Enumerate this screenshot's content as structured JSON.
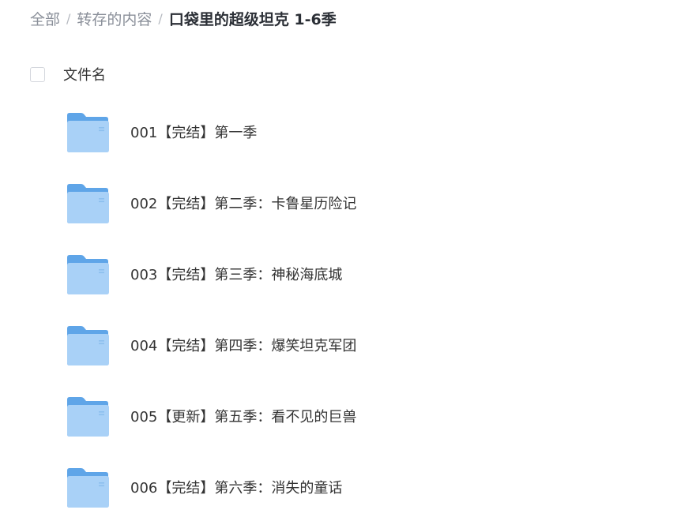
{
  "breadcrumb": {
    "root": "全部",
    "parent": "转存的内容",
    "separator": "/",
    "current": "口袋里的超级坦克 1-6季"
  },
  "header": {
    "column_label": "文件名"
  },
  "files": [
    {
      "name": "001【完结】第一季",
      "icon": "folder-icon"
    },
    {
      "name": "002【完结】第二季：卡鲁星历险记",
      "icon": "folder-icon"
    },
    {
      "name": "003【完结】第三季：神秘海底城",
      "icon": "folder-icon"
    },
    {
      "name": "004【完结】第四季：爆笑坦克军团",
      "icon": "folder-icon"
    },
    {
      "name": "005【更新】第五季：看不见的巨兽",
      "icon": "folder-icon"
    },
    {
      "name": "006【完结】第六季：消失的童话",
      "icon": "folder-icon"
    }
  ],
  "colors": {
    "folder_back": "#5fa5e8",
    "folder_front": "#a9d1f7",
    "crumb_link": "#8a8f99",
    "crumb_current": "#2b2f36"
  }
}
